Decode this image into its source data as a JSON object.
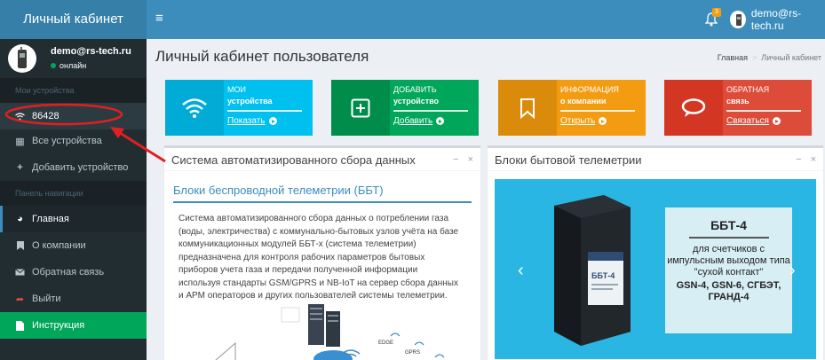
{
  "app": {
    "title": "Личный кабинет"
  },
  "topbar": {
    "notification_count": "3",
    "user_email": "demo@rs-tech.ru"
  },
  "sidebar": {
    "user": {
      "email": "demo@rs-tech.ru",
      "status": "онлайн"
    },
    "section_devices": "Мои устройства",
    "device_item": "86428",
    "all_devices": "Все устройства",
    "add_device": "Добавить устройство",
    "section_nav": "Панель навигации",
    "nav": {
      "home": "Главная",
      "about": "О компании",
      "feedback": "Обратная связь",
      "logout": "Выйти",
      "manual": "Инструкция"
    }
  },
  "page": {
    "title": "Личный кабинет пользователя",
    "breadcrumb": {
      "home": "Главная",
      "separator": ">",
      "current": "Личный кабинет"
    }
  },
  "tiles": [
    {
      "line1": "МОИ",
      "line2": "устройства",
      "action": "Показать",
      "color": "#00c0ef"
    },
    {
      "line1": "ДОБАВИТЬ",
      "line2": "устройство",
      "action": "Добавить",
      "color": "#00a65a"
    },
    {
      "line1": "ИНФОРМАЦИЯ",
      "line2": "о компании",
      "action": "Открыть",
      "color": "#f39c12"
    },
    {
      "line1": "ОБРАТНАЯ",
      "line2": "связь",
      "action": "Связаться",
      "color": "#dd4b39"
    }
  ],
  "box_left": {
    "title": "Система автоматизированного сбора данных",
    "subheader": "Блоки беспроводной телеметрии (ББТ)",
    "text": "Система автоматизированного сбора данных о потреблении газа (воды, электричества) с коммунально-бытовых узлов учёта на базе коммуникационных модулей ББТ-х (система телеметрии) предназначена для контроля рабочих параметров бытовых приборов учета газа и передачи полученной информации используя стандарты GSM/GPRS и NB-IoT на сервер сбора данных и АРМ операторов и других пользователей системы телеметрии.",
    "diagram": {
      "edge": "EDGE",
      "gprs": "GPRS"
    }
  },
  "box_right": {
    "title": "Блоки бытовой телеметрии",
    "product_label": "ББТ-4",
    "promo": {
      "heading": "ББТ-4",
      "body": "для счетчиков с импульсным выходом типа \"сухой контакт\"",
      "models": "GSN-4, GSN-6, СГБЭТ, ГРАНД-4"
    }
  },
  "box_tools": {
    "minimize": "−",
    "close": "×"
  },
  "colors": {
    "topbar": "#3c8dbc",
    "sidebar": "#222d32",
    "annotation": "#e02020"
  }
}
